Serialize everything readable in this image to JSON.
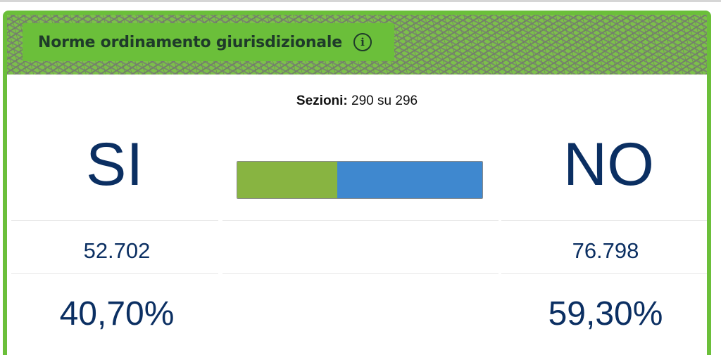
{
  "card": {
    "title": "Norme ordinamento giurisdizionale",
    "info_icon": "info-icon",
    "accent_color": "#6bbf3a"
  },
  "sezioni": {
    "label": "Sezioni:",
    "value": "290 su 296"
  },
  "si": {
    "label": "SI",
    "votes": "52.702",
    "percent": "40,70%",
    "percent_value": 40.7,
    "color": "#88b441"
  },
  "no": {
    "label": "NO",
    "votes": "76.798",
    "percent": "59,30%",
    "percent_value": 59.3,
    "color": "#3f88cf"
  }
}
